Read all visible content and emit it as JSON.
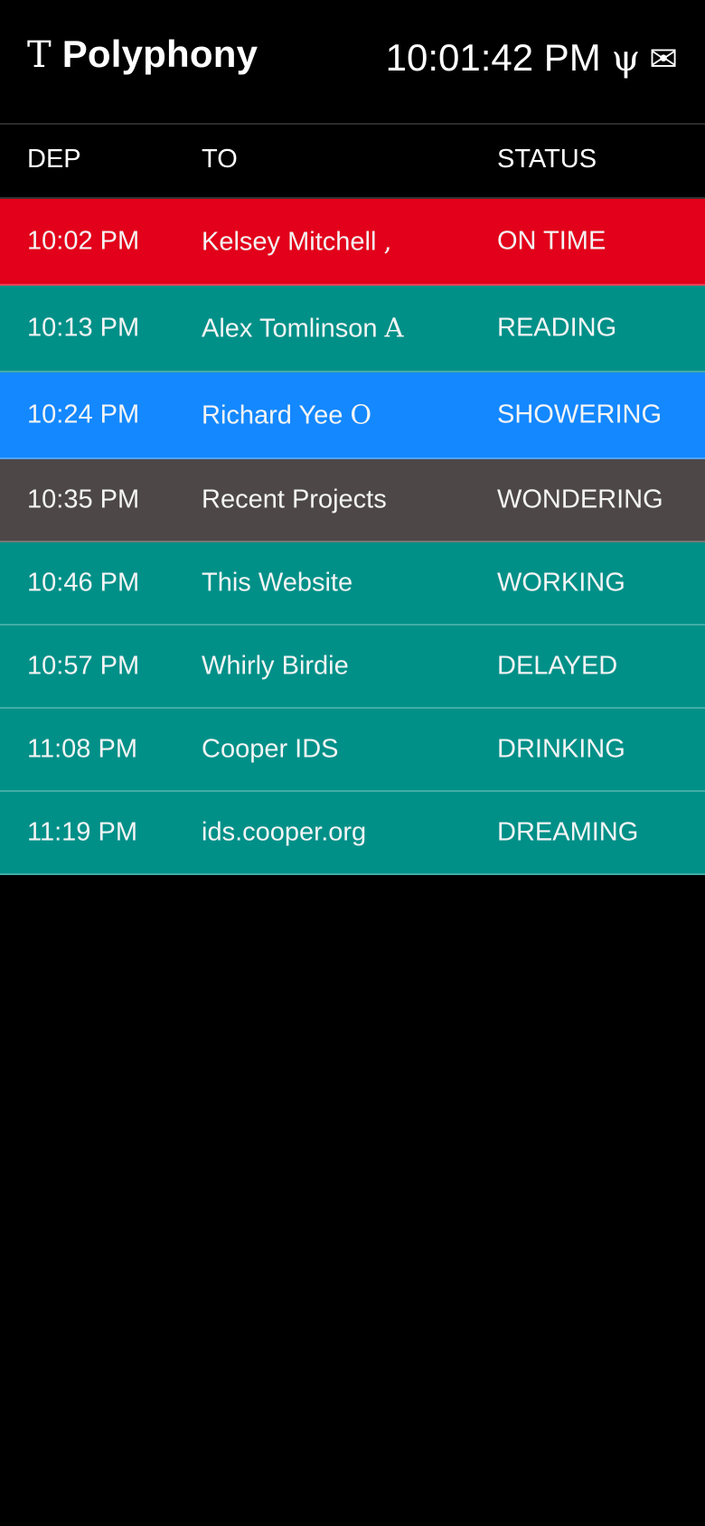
{
  "header": {
    "brand_glyph": "T",
    "brand_title": "Polyphony",
    "clock": "10:01:42 PM",
    "psi_icon": "ψ",
    "mail_icon": "✉"
  },
  "columns": {
    "dep": "DEP",
    "to": "TO",
    "status": "STATUS"
  },
  "colors": {
    "red": "#E2001A",
    "teal": "#009088",
    "blue": "#1488FF",
    "gray": "#4D4747"
  },
  "rows": [
    {
      "dep": "10:02 PM",
      "to": "Kelsey Mitchell",
      "to_glyph": ",",
      "status": "ON TIME",
      "color": "#E2001A"
    },
    {
      "dep": "10:13 PM",
      "to": "Alex Tomlinson",
      "to_glyph": "A",
      "status": "READING",
      "color": "#009088"
    },
    {
      "dep": "10:24 PM",
      "to": "Richard Yee",
      "to_glyph": "O",
      "status": "SHOWERING",
      "color": "#1488FF"
    },
    {
      "dep": "10:35 PM",
      "to": "Recent Projects",
      "to_glyph": "",
      "status": "WONDERING",
      "color": "#4D4747"
    },
    {
      "dep": "10:46 PM",
      "to": "This Website",
      "to_glyph": "",
      "status": "WORKING",
      "color": "#009088"
    },
    {
      "dep": "10:57 PM",
      "to": "Whirly Birdie",
      "to_glyph": "",
      "status": "DELAYED",
      "color": "#009088"
    },
    {
      "dep": "11:08 PM",
      "to": "Cooper IDS",
      "to_glyph": "",
      "status": "DRINKING",
      "color": "#009088"
    },
    {
      "dep": "11:19 PM",
      "to": "ids.cooper.org",
      "to_glyph": "",
      "status": "DREAMING",
      "color": "#009088"
    }
  ]
}
